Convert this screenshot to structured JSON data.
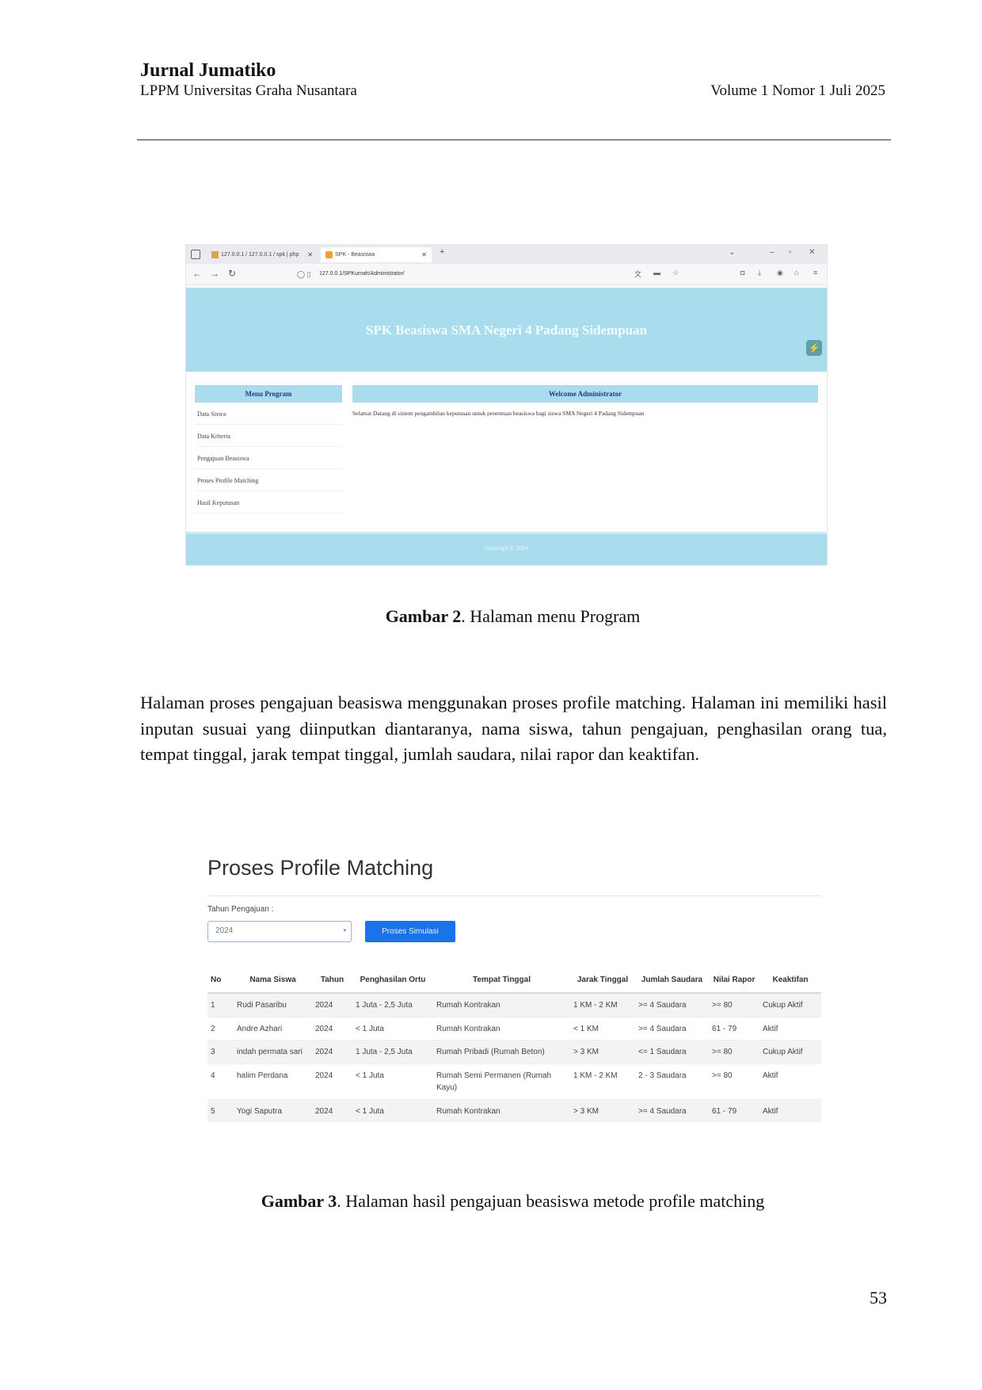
{
  "header": {
    "journal": "Jurnal Jumatiko",
    "publisher": "LPPM Universitas Graha Nusantara",
    "volume": "Volume 1  Nomor  1 Juli 2025"
  },
  "figure2": {
    "browser": {
      "tab1_label": "127.0.0.1 / 127.0.0.1 / spk | php",
      "tab2_label": "SPK - Beasiswa",
      "url": "127.0.0.1/SPKumah/Administrator/"
    },
    "app_title": "SPK Beasiswa SMA Negeri 4 Padang Sidempuan",
    "menu_title": "Menu Program",
    "menu_items": [
      "Data Siswa",
      "Data Kriteria",
      "Pengajuan Beasiswa",
      "Proses Profile Matching",
      "Hasil Keputusan"
    ],
    "welcome_title": "Welcome Administrator",
    "welcome_text": "Selamat Datang di sistem pengambilan keputusan untuk penentuan beasiswa bagi siswa SMA Negeri 4 Padang Sidempuan",
    "footer": "Copyright © 2024",
    "caption_label": "Gambar 2",
    "caption_text": ". Halaman menu Program"
  },
  "paragraph": "Halaman proses pengajuan beasiswa menggunakan proses profile matching. Halaman ini memiliki hasil inputan susuai yang diinputkan  diantaranya, nama siswa, tahun pengajuan, penghasilan orang tua, tempat tinggal, jarak tempat tinggal, jumlah saudara, nilai rapor dan keaktifan.",
  "figure3": {
    "title": "Proses Profile Matching",
    "field_label": "Tahun Pengajuan :",
    "selected_year": "2024",
    "button_label": "Proses Simulasi",
    "columns": [
      "No",
      "Nama Siswa",
      "Tahun",
      "Penghasilan Ortu",
      "Tempat Tinggal",
      "Jarak Tinggal",
      "Jumlah Saudara",
      "Nilai Rapor",
      "Keaktifan"
    ],
    "rows": [
      [
        "1",
        "Rudi Pasaribu",
        "2024",
        "1 Juta - 2,5 Juta",
        "Rumah Kontrakan",
        "1 KM - 2 KM",
        ">= 4 Saudara",
        ">= 80",
        "Cukup Aktif"
      ],
      [
        "2",
        "Andre Azhari",
        "2024",
        "< 1 Juta",
        "Rumah Kontrakan",
        "< 1 KM",
        ">= 4 Saudara",
        "61 - 79",
        "Aktif"
      ],
      [
        "3",
        "indah permata sari",
        "2024",
        "1 Juta - 2,5 Juta",
        "Rumah Pribadi (Rumah Beton)",
        "> 3 KM",
        "<= 1 Saudara",
        ">= 80",
        "Cukup Aktif"
      ],
      [
        "4",
        "halim Perdana",
        "2024",
        "< 1 Juta",
        "Rumah Semi Permanen (Rumah Kayu)",
        "1 KM - 2 KM",
        "2 - 3 Saudara",
        ">= 80",
        "Aktif"
      ],
      [
        "5",
        "Yogi Saputra",
        "2024",
        "< 1 Juta",
        "Rumah Kontrakan",
        "> 3 KM",
        ">= 4 Saudara",
        "61 - 79",
        "Aktif"
      ]
    ],
    "caption_label": "Gambar 3",
    "caption_text": ". Halaman hasil pengajuan beasiswa metode profile matching"
  },
  "page_number": "53"
}
